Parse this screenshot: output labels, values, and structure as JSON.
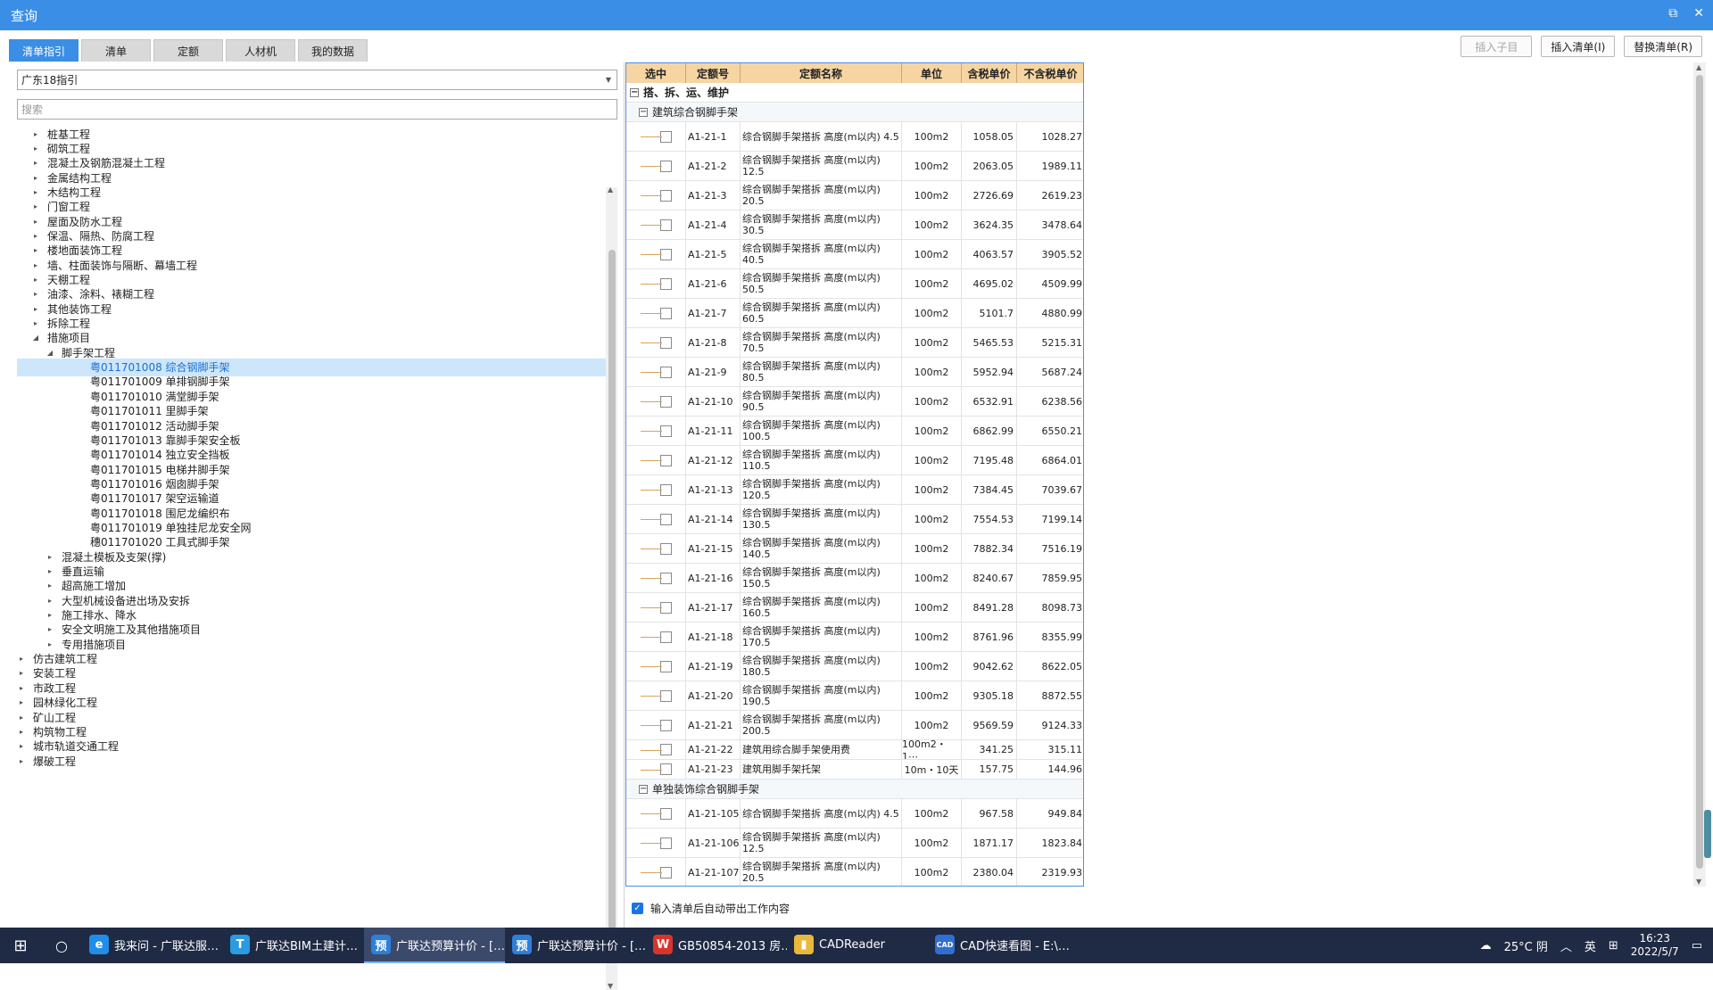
{
  "window": {
    "title": "查询",
    "restore_glyph": "⧉",
    "close_glyph": "✕"
  },
  "tabs": [
    {
      "label": "清单指引",
      "active": true
    },
    {
      "label": "清单",
      "active": false
    },
    {
      "label": "定额",
      "active": false
    },
    {
      "label": "人材机",
      "active": false
    },
    {
      "label": "我的数据",
      "active": false
    }
  ],
  "actions": {
    "insert_child": "插入子目",
    "insert_list": "插入清单(I)",
    "replace_list": "替换清单(R)"
  },
  "left": {
    "dropdown_value": "广东18指引",
    "search_placeholder": "搜索",
    "tree": [
      {
        "label": "桩基工程",
        "level": 1,
        "arrow": "▸"
      },
      {
        "label": "砌筑工程",
        "level": 1,
        "arrow": "▸"
      },
      {
        "label": "混凝土及钢筋混凝土工程",
        "level": 1,
        "arrow": "▸"
      },
      {
        "label": "金属结构工程",
        "level": 1,
        "arrow": "▸"
      },
      {
        "label": "木结构工程",
        "level": 1,
        "arrow": "▸"
      },
      {
        "label": "门窗工程",
        "level": 1,
        "arrow": "▸"
      },
      {
        "label": "屋面及防水工程",
        "level": 1,
        "arrow": "▸"
      },
      {
        "label": "保温、隔热、防腐工程",
        "level": 1,
        "arrow": "▸"
      },
      {
        "label": "楼地面装饰工程",
        "level": 1,
        "arrow": "▸"
      },
      {
        "label": "墙、柱面装饰与隔断、幕墙工程",
        "level": 1,
        "arrow": "▸"
      },
      {
        "label": "天棚工程",
        "level": 1,
        "arrow": "▸"
      },
      {
        "label": "油漆、涂料、裱糊工程",
        "level": 1,
        "arrow": "▸"
      },
      {
        "label": "其他装饰工程",
        "level": 1,
        "arrow": "▸"
      },
      {
        "label": "拆除工程",
        "level": 1,
        "arrow": "▸"
      },
      {
        "label": "措施项目",
        "level": 1,
        "arrow": "◢"
      },
      {
        "label": "脚手架工程",
        "level": 2,
        "arrow": "◢"
      },
      {
        "label": "粤011701008  综合钢脚手架",
        "level": 3,
        "arrow": "",
        "selected": true
      },
      {
        "label": "粤011701009  单排钢脚手架",
        "level": 3,
        "arrow": ""
      },
      {
        "label": "粤011701010  满堂脚手架",
        "level": 3,
        "arrow": ""
      },
      {
        "label": "粤011701011  里脚手架",
        "level": 3,
        "arrow": ""
      },
      {
        "label": "粤011701012  活动脚手架",
        "level": 3,
        "arrow": ""
      },
      {
        "label": "粤011701013  靠脚手架安全板",
        "level": 3,
        "arrow": ""
      },
      {
        "label": "粤011701014  独立安全挡板",
        "level": 3,
        "arrow": ""
      },
      {
        "label": "粤011701015  电梯井脚手架",
        "level": 3,
        "arrow": ""
      },
      {
        "label": "粤011701016  烟囱脚手架",
        "level": 3,
        "arrow": ""
      },
      {
        "label": "粤011701017  架空运输道",
        "level": 3,
        "arrow": ""
      },
      {
        "label": "粤011701018  围尼龙编织布",
        "level": 3,
        "arrow": ""
      },
      {
        "label": "粤011701019  单独挂尼龙安全网",
        "level": 3,
        "arrow": ""
      },
      {
        "label": "穗011701020  工具式脚手架",
        "level": 3,
        "arrow": ""
      },
      {
        "label": "混凝土模板及支架(撑)",
        "level": 2,
        "arrow": "▸"
      },
      {
        "label": "垂直运输",
        "level": 2,
        "arrow": "▸"
      },
      {
        "label": "超高施工增加",
        "level": 2,
        "arrow": "▸"
      },
      {
        "label": "大型机械设备进出场及安拆",
        "level": 2,
        "arrow": "▸"
      },
      {
        "label": "施工排水、降水",
        "level": 2,
        "arrow": "▸"
      },
      {
        "label": "安全文明施工及其他措施项目",
        "level": 2,
        "arrow": "▸"
      },
      {
        "label": "专用措施项目",
        "level": 2,
        "arrow": "▸"
      },
      {
        "label": "仿古建筑工程",
        "level": 0,
        "arrow": "▸"
      },
      {
        "label": "安装工程",
        "level": 0,
        "arrow": "▸"
      },
      {
        "label": "市政工程",
        "level": 0,
        "arrow": "▸"
      },
      {
        "label": "园林绿化工程",
        "level": 0,
        "arrow": "▸"
      },
      {
        "label": "矿山工程",
        "level": 0,
        "arrow": "▸"
      },
      {
        "label": "构筑物工程",
        "level": 0,
        "arrow": "▸"
      },
      {
        "label": "城市轨道交通工程",
        "level": 0,
        "arrow": "▸"
      },
      {
        "label": "爆破工程",
        "level": 0,
        "arrow": "▸"
      }
    ]
  },
  "grid": {
    "headers": [
      "选中",
      "定额号",
      "定额名称",
      "单位",
      "含税单价",
      "不含税单价"
    ],
    "group1": "搭、拆、运、维护",
    "group2": "建筑综合钢脚手架",
    "group3": "单独装饰综合钢脚手架",
    "collapse_glyph": "−",
    "rows_a": [
      {
        "code": "A1-21-1",
        "name": "综合钢脚手架搭拆 高度(m以内) 4.5",
        "unit": "100m2",
        "tax": "1058.05",
        "notax": "1028.27"
      },
      {
        "code": "A1-21-2",
        "name": "综合钢脚手架搭拆 高度(m以内) 12.5",
        "unit": "100m2",
        "tax": "2063.05",
        "notax": "1989.11"
      },
      {
        "code": "A1-21-3",
        "name": "综合钢脚手架搭拆 高度(m以内) 20.5",
        "unit": "100m2",
        "tax": "2726.69",
        "notax": "2619.23"
      },
      {
        "code": "A1-21-4",
        "name": "综合钢脚手架搭拆 高度(m以内) 30.5",
        "unit": "100m2",
        "tax": "3624.35",
        "notax": "3478.64"
      },
      {
        "code": "A1-21-5",
        "name": "综合钢脚手架搭拆 高度(m以内) 40.5",
        "unit": "100m2",
        "tax": "4063.57",
        "notax": "3905.52"
      },
      {
        "code": "A1-21-6",
        "name": "综合钢脚手架搭拆 高度(m以内) 50.5",
        "unit": "100m2",
        "tax": "4695.02",
        "notax": "4509.99"
      },
      {
        "code": "A1-21-7",
        "name": "综合钢脚手架搭拆 高度(m以内) 60.5",
        "unit": "100m2",
        "tax": "5101.7",
        "notax": "4880.99"
      },
      {
        "code": "A1-21-8",
        "name": "综合钢脚手架搭拆 高度(m以内) 70.5",
        "unit": "100m2",
        "tax": "5465.53",
        "notax": "5215.31"
      },
      {
        "code": "A1-21-9",
        "name": "综合钢脚手架搭拆 高度(m以内) 80.5",
        "unit": "100m2",
        "tax": "5952.94",
        "notax": "5687.24"
      },
      {
        "code": "A1-21-10",
        "name": "综合钢脚手架搭拆 高度(m以内) 90.5",
        "unit": "100m2",
        "tax": "6532.91",
        "notax": "6238.56"
      },
      {
        "code": "A1-21-11",
        "name": "综合钢脚手架搭拆 高度(m以内) 100.5",
        "unit": "100m2",
        "tax": "6862.99",
        "notax": "6550.21"
      },
      {
        "code": "A1-21-12",
        "name": "综合钢脚手架搭拆 高度(m以内) 110.5",
        "unit": "100m2",
        "tax": "7195.48",
        "notax": "6864.01"
      },
      {
        "code": "A1-21-13",
        "name": "综合钢脚手架搭拆 高度(m以内) 120.5",
        "unit": "100m2",
        "tax": "7384.45",
        "notax": "7039.67"
      },
      {
        "code": "A1-21-14",
        "name": "综合钢脚手架搭拆 高度(m以内) 130.5",
        "unit": "100m2",
        "tax": "7554.53",
        "notax": "7199.14"
      },
      {
        "code": "A1-21-15",
        "name": "综合钢脚手架搭拆 高度(m以内) 140.5",
        "unit": "100m2",
        "tax": "7882.34",
        "notax": "7516.19"
      },
      {
        "code": "A1-21-16",
        "name": "综合钢脚手架搭拆 高度(m以内) 150.5",
        "unit": "100m2",
        "tax": "8240.67",
        "notax": "7859.95"
      },
      {
        "code": "A1-21-17",
        "name": "综合钢脚手架搭拆 高度(m以内) 160.5",
        "unit": "100m2",
        "tax": "8491.28",
        "notax": "8098.73"
      },
      {
        "code": "A1-21-18",
        "name": "综合钢脚手架搭拆 高度(m以内) 170.5",
        "unit": "100m2",
        "tax": "8761.96",
        "notax": "8355.99"
      },
      {
        "code": "A1-21-19",
        "name": "综合钢脚手架搭拆 高度(m以内) 180.5",
        "unit": "100m2",
        "tax": "9042.62",
        "notax": "8622.05"
      },
      {
        "code": "A1-21-20",
        "name": "综合钢脚手架搭拆 高度(m以内) 190.5",
        "unit": "100m2",
        "tax": "9305.18",
        "notax": "8872.55"
      },
      {
        "code": "A1-21-21",
        "name": "综合钢脚手架搭拆 高度(m以内) 200.5",
        "unit": "100m2",
        "tax": "9569.59",
        "notax": "9124.33"
      },
      {
        "code": "A1-21-22",
        "name": "建筑用综合脚手架使用费",
        "unit": "100m2・1⋯",
        "tax": "341.25",
        "notax": "315.11",
        "single": true
      },
      {
        "code": "A1-21-23",
        "name": "建筑用脚手架托架",
        "unit": "10m・10天",
        "tax": "157.75",
        "notax": "144.96",
        "single": true
      }
    ],
    "rows_b": [
      {
        "code": "A1-21-105",
        "name": "综合钢脚手架搭拆 高度(m以内) 4.5",
        "unit": "100m2",
        "tax": "967.58",
        "notax": "949.84"
      },
      {
        "code": "A1-21-106",
        "name": "综合钢脚手架搭拆 高度(m以内) 12.5",
        "unit": "100m2",
        "tax": "1871.17",
        "notax": "1823.84"
      },
      {
        "code": "A1-21-107",
        "name": "综合钢脚手架搭拆 高度(m以内) 20.5",
        "unit": "100m2",
        "tax": "2380.04",
        "notax": "2319.93"
      }
    ]
  },
  "auto_check_label": "输入清单后自动带出工作内容",
  "taskbar": {
    "apps": [
      {
        "label": "我来问 - 广联达服…",
        "icon": "e",
        "color": "#1f8ee8",
        "active": false
      },
      {
        "label": "广联达BIM土建计…",
        "icon": "T",
        "color": "#2a9be0",
        "active": false
      },
      {
        "label": "广联达预算计价 - […",
        "icon": "预",
        "color": "#2d7fd8",
        "active": true
      },
      {
        "label": "广联达预算计价 - […",
        "icon": "预",
        "color": "#2d7fd8",
        "active": false
      },
      {
        "label": "GB50854-2013 房…",
        "icon": "W",
        "color": "#d9342b",
        "active": false
      },
      {
        "label": "CADReader",
        "icon": "▮",
        "color": "#e8b93a",
        "active": false
      },
      {
        "label": "CAD快速看图 - E:\\…",
        "icon": "CAD",
        "color": "#2f6fd1",
        "active": false
      }
    ],
    "weather": "25°C 阴",
    "ime": "英",
    "time": "16:23",
    "date": "2022/5/7"
  }
}
